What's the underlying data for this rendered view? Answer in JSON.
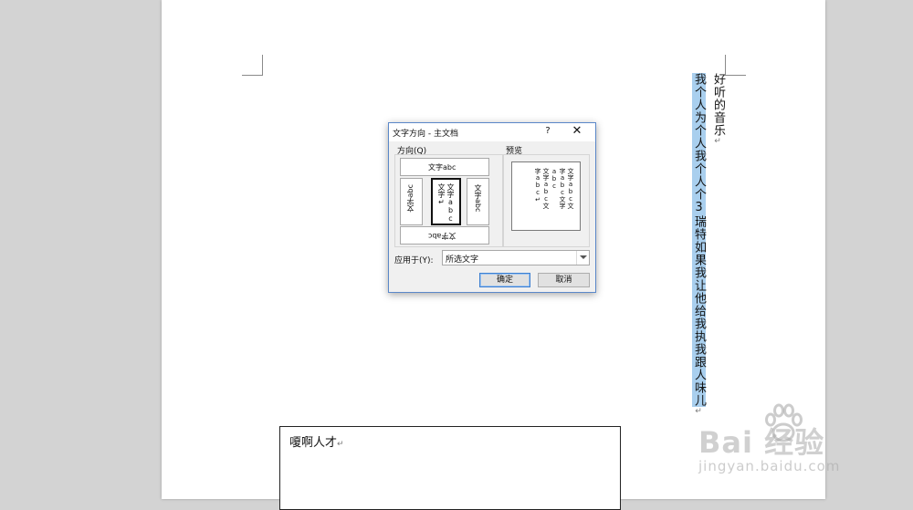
{
  "document": {
    "column_right": "好听的音乐",
    "column_left": "我个人为个人我个人个3瑞特如果我让他给我执我跟人味儿",
    "paragraph_mark": "↵",
    "textbox_text": "嗄啊人才"
  },
  "dialog": {
    "title": "文字方向 - 主文档",
    "help": "?",
    "close": "✕",
    "orientation_label": "方向(Q)",
    "preview_label": "预览",
    "orientations": {
      "horizontal": "文字abc",
      "vertical_left": "文字abc",
      "vertical_stacked": [
        "文字abc",
        "文字↵"
      ],
      "vertical_right": "文字abc",
      "horizontal_flipped": "文字abc"
    },
    "preview_lines": [
      "文字abc文",
      "字abc文字abc",
      "文字abc文",
      "字abc↵"
    ],
    "apply_to_label": "应用于(Y):",
    "apply_to_value": "所选文字",
    "ok_label": "确定",
    "cancel_label": "取消"
  },
  "watermark": {
    "brand": "Bai  经验",
    "url": "jingyan.baidu.com"
  }
}
